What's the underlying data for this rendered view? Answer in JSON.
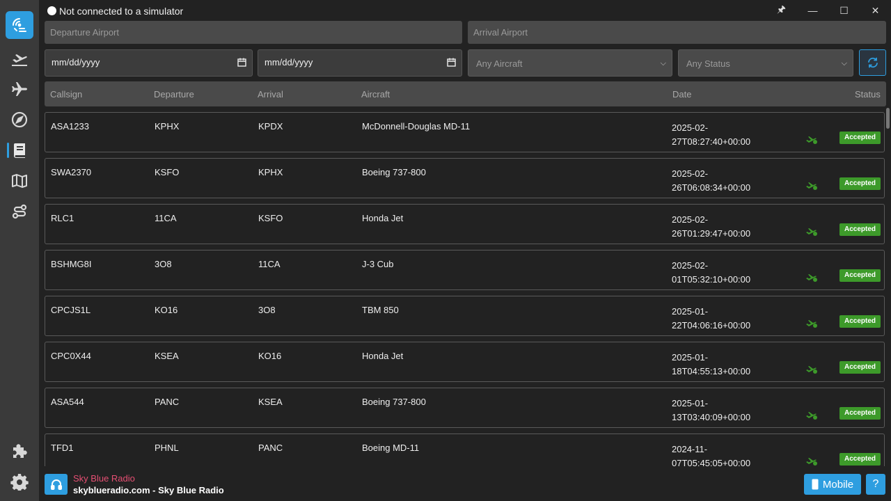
{
  "titlebar": {
    "status": "Not connected to a simulator",
    "pin_glyph": "🖈",
    "minimize_glyph": "—",
    "maximize_glyph": "☐",
    "close_glyph": "✕"
  },
  "filters": {
    "departure_placeholder": "Departure Airport",
    "arrival_placeholder": "Arrival Airport",
    "date_from": "mm/dd/yyyy",
    "date_to": "mm/dd/yyyy",
    "aircraft": "Any Aircraft",
    "status": "Any Status"
  },
  "table": {
    "headers": {
      "callsign": "Callsign",
      "departure": "Departure",
      "arrival": "Arrival",
      "aircraft": "Aircraft",
      "date": "Date",
      "status": "Status"
    },
    "rows": [
      {
        "callsign": "ASA1233",
        "departure": "KPHX",
        "arrival": "KPDX",
        "aircraft": "McDonnell-Douglas MD-11",
        "date_line1": "2025-02-",
        "date_line2": "27T08:27:40+00:00",
        "status": "Accepted"
      },
      {
        "callsign": "SWA2370",
        "departure": "KSFO",
        "arrival": "KPHX",
        "aircraft": "Boeing 737-800",
        "date_line1": "2025-02-",
        "date_line2": "26T06:08:34+00:00",
        "status": "Accepted"
      },
      {
        "callsign": "RLC1",
        "departure": "11CA",
        "arrival": "KSFO",
        "aircraft": "Honda Jet",
        "date_line1": "2025-02-",
        "date_line2": "26T01:29:47+00:00",
        "status": "Accepted"
      },
      {
        "callsign": "BSHMG8I",
        "departure": "3O8",
        "arrival": "11CA",
        "aircraft": "J-3 Cub",
        "date_line1": "2025-02-",
        "date_line2": "01T05:32:10+00:00",
        "status": "Accepted"
      },
      {
        "callsign": "CPCJS1L",
        "departure": "KO16",
        "arrival": "3O8",
        "aircraft": "TBM 850",
        "date_line1": "2025-01-",
        "date_line2": "22T04:06:16+00:00",
        "status": "Accepted"
      },
      {
        "callsign": "CPC0X44",
        "departure": "KSEA",
        "arrival": "KO16",
        "aircraft": "Honda Jet",
        "date_line1": "2025-01-",
        "date_line2": "18T04:55:13+00:00",
        "status": "Accepted"
      },
      {
        "callsign": "ASA544",
        "departure": "PANC",
        "arrival": "KSEA",
        "aircraft": "Boeing 737-800",
        "date_line1": "2025-01-",
        "date_line2": "13T03:40:09+00:00",
        "status": "Accepted"
      },
      {
        "callsign": "TFD1",
        "departure": "PHNL",
        "arrival": "PANC",
        "aircraft": "Boeing MD-11",
        "date_line1": "2024-11-",
        "date_line2": "07T05:45:05+00:00",
        "status": "Accepted"
      }
    ]
  },
  "footer": {
    "radio_name": "Sky Blue Radio",
    "radio_subtitle": "skyblueradio.com - Sky Blue Radio",
    "mobile_label": "Mobile",
    "help_label": "?"
  },
  "colors": {
    "accent": "#2e9ee0",
    "accepted": "#3d9a2a",
    "radio_name": "#e64f73"
  }
}
